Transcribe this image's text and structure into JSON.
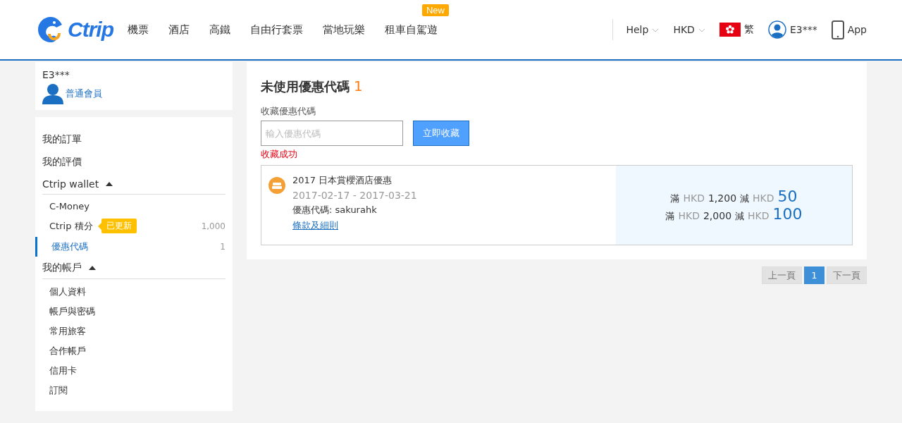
{
  "header": {
    "logo": "Ctrip",
    "nav": [
      {
        "label": "機票"
      },
      {
        "label": "酒店"
      },
      {
        "label": "高鐵"
      },
      {
        "label": "自由行套票"
      },
      {
        "label": "當地玩樂"
      },
      {
        "label": "租車自駕遊",
        "badge": "New"
      }
    ],
    "help": "Help",
    "currency": "HKD",
    "language": "繁",
    "user": "E3***",
    "app": "App"
  },
  "sidebar": {
    "profile": {
      "name": "E3***",
      "level": "普通會員"
    },
    "menu": [
      {
        "kind": "link",
        "label": "我的訂單"
      },
      {
        "kind": "link",
        "label": "我的評價"
      },
      {
        "kind": "section",
        "label": "Ctrip wallet",
        "expanded": true,
        "children": [
          {
            "label": "C-Money",
            "selected": false
          },
          {
            "label": "Ctrip 積分",
            "badge": "已更新",
            "count": "1,000",
            "selected": false
          },
          {
            "label": "優惠代碼",
            "count": "1",
            "selected": true
          }
        ]
      },
      {
        "kind": "section",
        "label": "我的帳戶",
        "expanded": true,
        "children": [
          {
            "label": "個人資料",
            "selected": false
          },
          {
            "label": "帳戶與密碼",
            "selected": false
          },
          {
            "label": "常用旅客",
            "selected": false
          },
          {
            "label": "合作帳戶",
            "selected": false
          },
          {
            "label": "信用卡",
            "selected": false
          },
          {
            "label": "訂閱",
            "selected": false
          }
        ]
      }
    ]
  },
  "main": {
    "title": "未使用優惠代碼",
    "count": "1",
    "collect_label": "收藏優惠代碼",
    "input": {
      "placeholder": "輸入優惠代碼"
    },
    "button": "立即收藏",
    "message": "收藏成功",
    "coupons": [
      {
        "title": "2017 日本賞櫻酒店優惠",
        "dates": "2017-02-17 - 2017-03-21",
        "code": "優惠代碼: sakurahk",
        "terms": "條款及細則",
        "rules": [
          {
            "spend_word": "滿",
            "spend_currency": "HKD",
            "spend": "1,200",
            "off_word": "減",
            "off_currency": "HKD",
            "off": "50"
          },
          {
            "spend_word": "滿",
            "spend_currency": "HKD",
            "spend": "2,000",
            "off_word": "減",
            "off_currency": "HKD",
            "off": "100"
          }
        ]
      }
    ]
  },
  "pagination": {
    "prev": {
      "label": "上一頁",
      "disabled": true
    },
    "pages": [
      {
        "label": "1",
        "selected": true
      }
    ],
    "next": {
      "label": "下一頁",
      "disabled": true
    }
  }
}
